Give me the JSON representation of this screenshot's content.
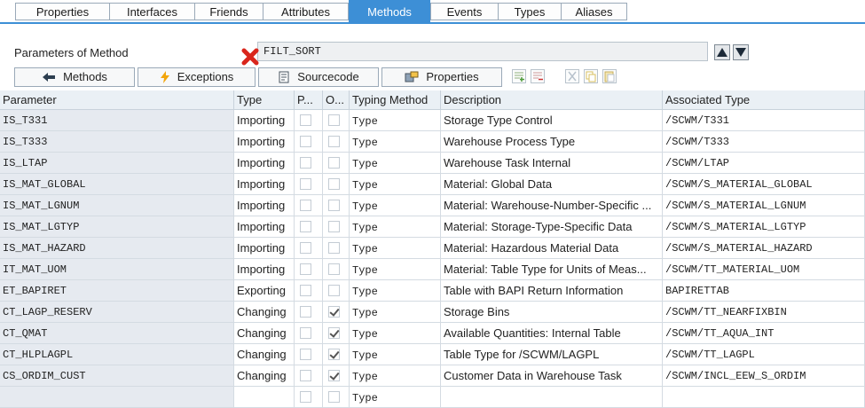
{
  "tabs": [
    {
      "label": "Properties",
      "active": false
    },
    {
      "label": "Interfaces",
      "active": false
    },
    {
      "label": "Friends",
      "active": false
    },
    {
      "label": "Attributes",
      "active": false
    },
    {
      "label": "Methods",
      "active": true
    },
    {
      "label": "Events",
      "active": false
    },
    {
      "label": "Types",
      "active": false
    },
    {
      "label": "Aliases",
      "active": false
    }
  ],
  "params_header": {
    "label": "Parameters of Method",
    "method_name": "FILT_SORT"
  },
  "toolbar": {
    "methods_label": "Methods",
    "exceptions_label": "Exceptions",
    "sourcecode_label": "Sourcecode",
    "properties_label": "Properties"
  },
  "table": {
    "columns": [
      "Parameter",
      "Type",
      "P...",
      "O...",
      "Typing Method",
      "Description",
      "Associated Type"
    ],
    "rows": [
      {
        "param": "IS_T331",
        "type": "Importing",
        "p": false,
        "o": false,
        "typing": "Type",
        "desc": "Storage Type Control",
        "assoc": "/SCWM/T331"
      },
      {
        "param": "IS_T333",
        "type": "Importing",
        "p": false,
        "o": false,
        "typing": "Type",
        "desc": "Warehouse Process Type",
        "assoc": "/SCWM/T333"
      },
      {
        "param": "IS_LTAP",
        "type": "Importing",
        "p": false,
        "o": false,
        "typing": "Type",
        "desc": "Warehouse Task Internal",
        "assoc": "/SCWM/LTAP"
      },
      {
        "param": "IS_MAT_GLOBAL",
        "type": "Importing",
        "p": false,
        "o": false,
        "typing": "Type",
        "desc": "Material: Global Data",
        "assoc": "/SCWM/S_MATERIAL_GLOBAL"
      },
      {
        "param": "IS_MAT_LGNUM",
        "type": "Importing",
        "p": false,
        "o": false,
        "typing": "Type",
        "desc": "Material: Warehouse-Number-Specific ...",
        "assoc": "/SCWM/S_MATERIAL_LGNUM"
      },
      {
        "param": "IS_MAT_LGTYP",
        "type": "Importing",
        "p": false,
        "o": false,
        "typing": "Type",
        "desc": "Material: Storage-Type-Specific Data",
        "assoc": "/SCWM/S_MATERIAL_LGTYP"
      },
      {
        "param": "IS_MAT_HAZARD",
        "type": "Importing",
        "p": false,
        "o": false,
        "typing": "Type",
        "desc": "Material: Hazardous Material Data",
        "assoc": "/SCWM/S_MATERIAL_HAZARD"
      },
      {
        "param": "IT_MAT_UOM",
        "type": "Importing",
        "p": false,
        "o": false,
        "typing": "Type",
        "desc": "Material: Table Type for Units of Meas...",
        "assoc": "/SCWM/TT_MATERIAL_UOM"
      },
      {
        "param": "ET_BAPIRET",
        "type": "Exporting",
        "p": false,
        "o": false,
        "typing": "Type",
        "desc": "Table with BAPI Return Information",
        "assoc": "BAPIRETTAB"
      },
      {
        "param": "CT_LAGP_RESERV",
        "type": "Changing",
        "p": false,
        "o": true,
        "typing": "Type",
        "desc": "Storage Bins",
        "assoc": "/SCWM/TT_NEARFIXBIN"
      },
      {
        "param": "CT_QMAT",
        "type": "Changing",
        "p": false,
        "o": true,
        "typing": "Type",
        "desc": "Available Quantities: Internal Table",
        "assoc": "/SCWM/TT_AQUA_INT"
      },
      {
        "param": "CT_HLPLAGPL",
        "type": "Changing",
        "p": false,
        "o": true,
        "typing": "Type",
        "desc": "Table Type for /SCWM/LAGPL",
        "assoc": "/SCWM/TT_LAGPL"
      },
      {
        "param": "CS_ORDIM_CUST",
        "type": "Changing",
        "p": false,
        "o": true,
        "typing": "Type",
        "desc": "Customer Data in Warehouse Task",
        "assoc": "/SCWM/INCL_EEW_S_ORDIM"
      },
      {
        "param": "",
        "type": "",
        "p": false,
        "o": false,
        "typing": "Type",
        "desc": "",
        "assoc": ""
      }
    ]
  }
}
